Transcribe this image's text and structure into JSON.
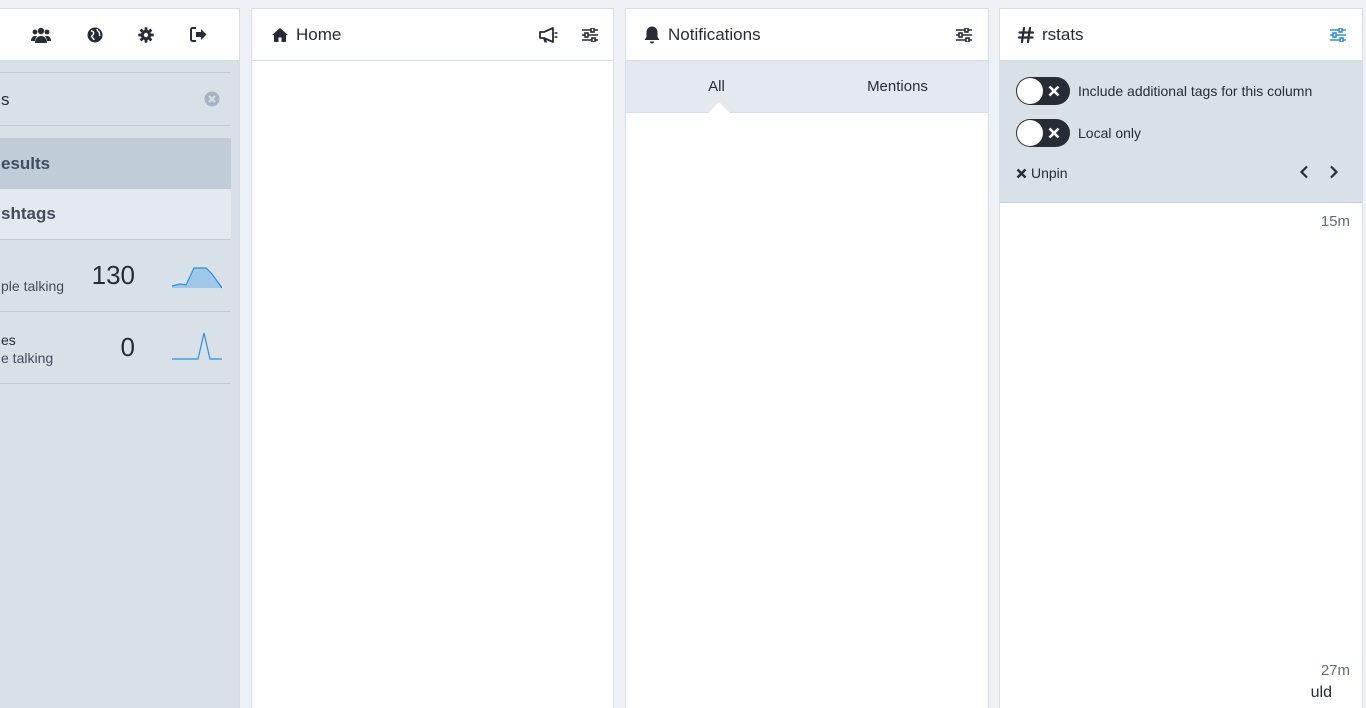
{
  "drawer": {
    "nav_icons": [
      "people-icon",
      "globe-icon",
      "gear-icon",
      "logout-icon"
    ],
    "search": {
      "value": "s"
    },
    "results_label": "esults",
    "hashtags_label": "shtags",
    "tags": [
      {
        "name": "",
        "talking": "ple talking",
        "count": "130"
      },
      {
        "name": "es",
        "talking": "e talking",
        "count": "0"
      }
    ]
  },
  "home": {
    "title": "Home"
  },
  "notifications": {
    "title": "Notifications",
    "tabs": [
      "All",
      "Mentions"
    ]
  },
  "hashtag_column": {
    "title": "rstats",
    "toggle_additional": "Include additional tags for this column",
    "toggle_local": "Local only",
    "unpin": "Unpin",
    "timestamp1": "15m",
    "timestamp2": "27m",
    "partial_text": "uld"
  },
  "colors": {
    "accent": "#2b90d9",
    "drawer_bg": "#d9e1e8",
    "tab_bg": "#e3e9ef"
  }
}
